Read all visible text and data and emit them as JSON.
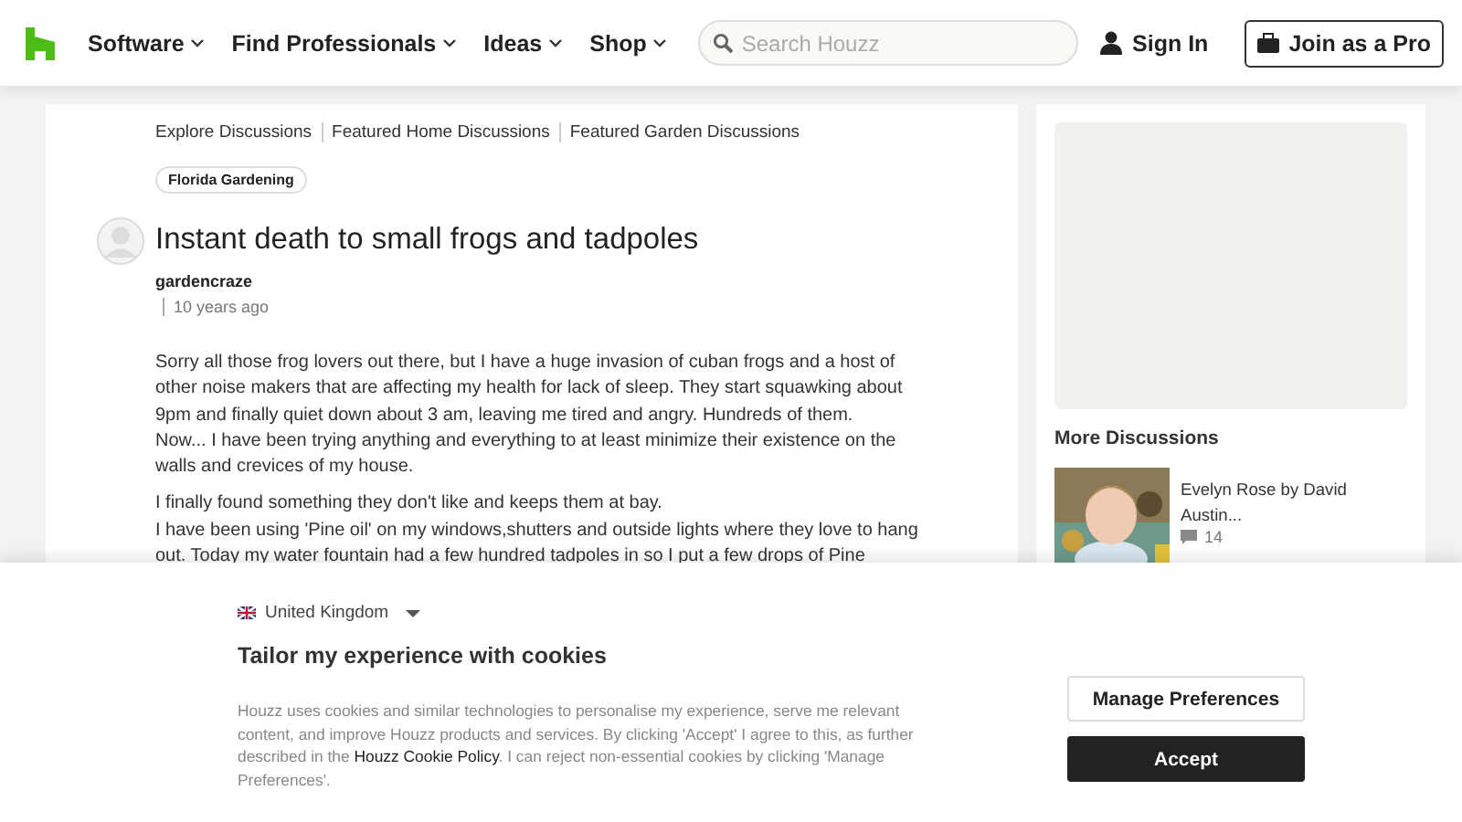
{
  "header": {
    "nav": [
      "Software",
      "Find Professionals",
      "Ideas",
      "Shop"
    ],
    "search": {
      "placeholder": "Search Houzz"
    },
    "sign_in": "Sign In",
    "join": "Join as a Pro"
  },
  "breadcrumbs": [
    "Explore Discussions",
    "Featured Home Discussions",
    "Featured Garden Discussions"
  ],
  "tag": "Florida Gardening",
  "post": {
    "title": "Instant death to small frogs and tadpoles",
    "author": "gardencraze",
    "time": "10 years ago",
    "paragraphs": [
      [
        "Sorry all those frog lovers out there, but I have a huge invasion of cuban frogs and a host of other noise makers that are affecting my health for lack of sleep. They start squawking about 9pm and finally quiet down about 3 am, leaving me tired and angry. Hundreds of them.",
        "Now... I have been trying anything and everything to at least minimize their existence on the walls and crevices of my house."
      ],
      [
        "I finally found something they don't like and keeps them at bay.",
        "I have been using 'Pine oil' on my windows,shutters and outside lights where they love to hang out. Today my water fountain had a few hundred tadpoles in so I put a few drops of Pine"
      ]
    ]
  },
  "sidebar": {
    "heading": "More Discussions",
    "items": [
      {
        "kind": "picture",
        "title": "Evelyn Rose by David Austin...",
        "comments": "14"
      }
    ]
  },
  "cookie_banner": {
    "region": "United Kingdom",
    "title": "Tailor my experience with cookies",
    "text_before": "Houzz uses cookies and similar technologies to personalise my experience, serve me relevant content, and improve Houzz products and services. By clicking 'Accept' I agree to this, as further described in the ",
    "link": "Houzz Cookie Policy",
    "text_after": ". I can reject non-essential cookies by clicking 'Manage Preferences'.",
    "buttons": [
      "Manage Preferences",
      "Accept"
    ]
  }
}
